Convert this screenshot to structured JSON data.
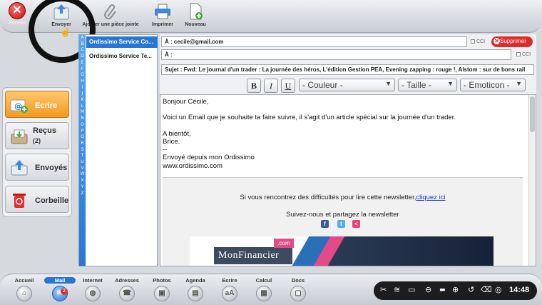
{
  "toolbar": {
    "close_label": "Fermer",
    "send_label": "Envoyer",
    "attach_label": "Ajouter une pièce jointe",
    "print_label": "Imprimer",
    "new_label": "Nouveau"
  },
  "nav": {
    "write_label": "Ecrire",
    "received_label": "Reçus",
    "received_count": "(2)",
    "sent_label": "Envoyés",
    "trash_label": "Corbeille"
  },
  "alphabet": [
    "A",
    "B",
    "C",
    "D",
    "E",
    "F",
    "G",
    "H",
    "I",
    "J",
    "K",
    "L",
    "M",
    "N",
    "O",
    "P",
    "Q",
    "R",
    "S",
    "T",
    "U",
    "V",
    "W",
    "X",
    "Y",
    "Z"
  ],
  "contacts": [
    "Ordissimo Service Co...",
    "Ordissimo Service Te..."
  ],
  "compose": {
    "to_value": "À :  cecile@gmail.com",
    "to2_value": "À :",
    "cci_label": "CCI",
    "delete_label": "Supprimer",
    "subject_value": "Sujet :  Fwd: Le journal d'un trader : La journée des héros, L'édition Gestion PEA, Evening zapping : rouge !, Alstom : sur de bons rail",
    "bold_label": "B",
    "italic_label": "I",
    "underline_label": "U",
    "color_select": "- Couleur -",
    "size_select": "- Taille -",
    "emoticon_select": "- Emoticon -"
  },
  "body": {
    "greeting": "Bonjour Cécile,",
    "line1": "Voici un Email que je souhaite ta faire suivre, il s'agit d'un article spécial sur la journée d'un trader.",
    "signoff": "A bientôt,",
    "name": "Brice.",
    "sep": "--",
    "sent_from": "Envoyé depuis mon Ordissimo",
    "site": "www.ordissimo.com"
  },
  "newsletter": {
    "difficulty_text": "Si vous rencontrez des difficultés pour lire cette newsletter,",
    "click_here": "cliquez ici",
    "follow_text": "Suivez-nous et partagez la newsletter",
    "logo_text": "MonFinancier",
    "logo_com": ".com"
  },
  "dock": [
    {
      "label": "Accueil",
      "glyph": "⌂"
    },
    {
      "label": "Mail",
      "glyph": "✉",
      "badge": "2"
    },
    {
      "label": "Internet",
      "glyph": "◍"
    },
    {
      "label": "Adresses",
      "glyph": "☎"
    },
    {
      "label": "Photos",
      "glyph": "▣"
    },
    {
      "label": "Agenda",
      "glyph": "▤"
    },
    {
      "label": "Ecrire",
      "glyph": "aA"
    },
    {
      "label": "Calcul",
      "glyph": "▦"
    },
    {
      "label": "Docs",
      "glyph": "▢"
    }
  ],
  "tray": {
    "time": "14:48"
  },
  "colors": {
    "accent": "#2a76d4",
    "write_orange": "#f39a1f",
    "delete_red": "#e22a2a"
  }
}
